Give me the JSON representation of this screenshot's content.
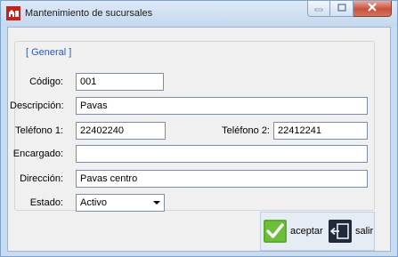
{
  "window": {
    "title": "Mantenimiento de sucursales"
  },
  "group": {
    "legend": "[ General ]"
  },
  "fields": {
    "codigo": {
      "label": "Código:",
      "value": "001"
    },
    "descripcion": {
      "label": "Descripción:",
      "value": "Pavas"
    },
    "telefono1": {
      "label": "Teléfono 1:",
      "value": "22402240"
    },
    "telefono2": {
      "label": "Teléfono 2:",
      "value": "22412241"
    },
    "encargado": {
      "label": "Encargado:",
      "value": ""
    },
    "direccion": {
      "label": "Dirección:",
      "value": "Pavas centro"
    },
    "estado": {
      "label": "Estado:",
      "value": "Activo"
    }
  },
  "actions": {
    "accept_label": "aceptar",
    "exit_label": "salir"
  },
  "icons": {
    "app": "app-logo-icon",
    "minimize": "minimize-icon",
    "maximize": "maximize-icon",
    "close": "close-icon",
    "accept": "checkmark-icon",
    "exit": "exit-door-icon"
  },
  "colors": {
    "titlebar": "#c5d8ee",
    "close_button": "#c7503a",
    "legend_text": "#2b5aa8",
    "accept_green": "#5aa62a",
    "exit_dark": "#1f2a3a"
  }
}
